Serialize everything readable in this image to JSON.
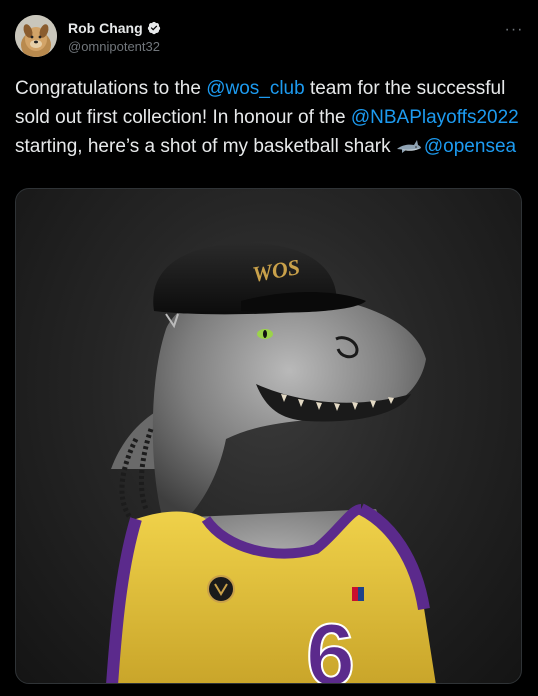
{
  "author": {
    "display_name": "Rob Chang",
    "handle": "@omnipotent32",
    "verified": true,
    "avatar_icon": "dog-avatar-icon"
  },
  "menu": {
    "more_label": "···"
  },
  "tweet": {
    "segments": [
      {
        "type": "text",
        "value": "Congratulations to the "
      },
      {
        "type": "mention",
        "value": "@wos_club"
      },
      {
        "type": "text",
        "value": " team for the successful sold out first collection! In honour of the "
      },
      {
        "type": "mention",
        "value": "@NBAPlayoffs2022"
      },
      {
        "type": "text",
        "value": " starting, here’s a shot of my basketball shark "
      },
      {
        "type": "emoji",
        "value": "shark-emoji-icon"
      },
      {
        "type": "mention",
        "value": "@opensea"
      }
    ]
  },
  "media": {
    "cap_logo_text": "WOS",
    "jersey_number": "6",
    "colors": {
      "jersey_yellow": "#e8c53a",
      "jersey_purple": "#5b2a8c",
      "mention_blue": "#1d9bf0",
      "cap_gold": "#c9a14a"
    }
  }
}
